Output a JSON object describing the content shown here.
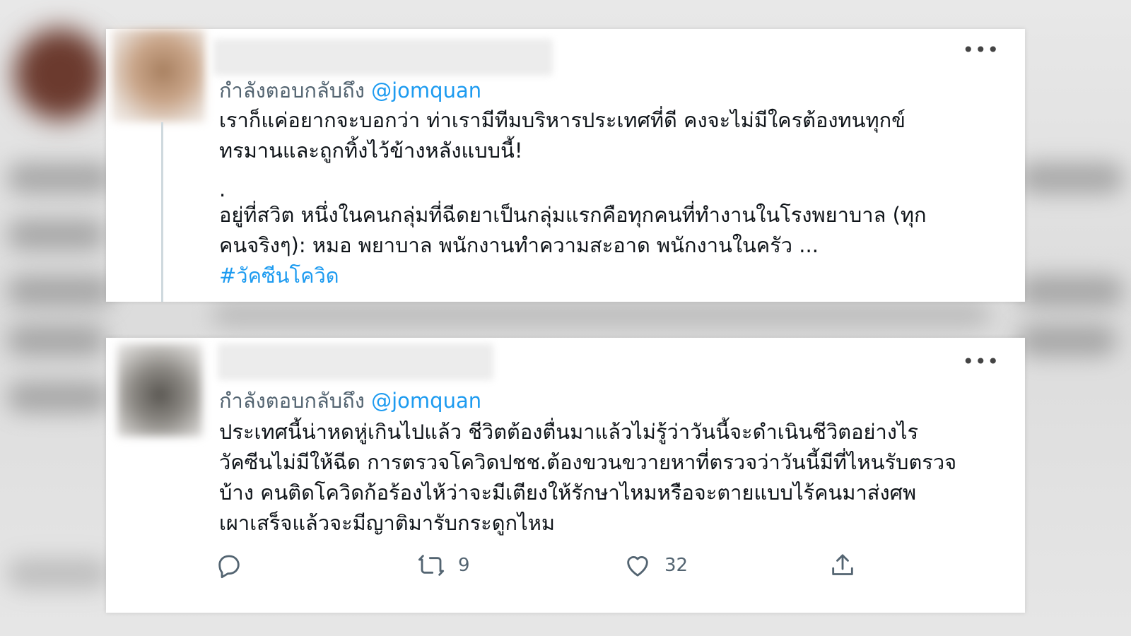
{
  "tweets": [
    {
      "reply_prefix": "กำลังตอบกลับถึง",
      "mention": "@jomquan",
      "text_lines": [
        "เราก็แค่อยากจะบอกว่า ท่าเรามีทีมบริหารประเทศที่ดี คงจะไม่มีใครต้องทนทุกข์",
        "ทรมานและถูกทิ้งไว้ข้างหลังแบบนี้!",
        ".",
        "อยู่ที่สวิต หนึ่งในคนกลุ่มที่ฉีดยาเป็นกลุ่มแรกคือทุกคนที่ทำงานในโรงพยาบาล (ทุก",
        "คนจริงๆ): หมอ พยาบาล พนักงานทำความสะอาด พนักงานในครัว ..."
      ],
      "hashtag": "#วัคซีนโควิด",
      "more_icon": "more-horizontal-icon"
    },
    {
      "reply_prefix": "กำลังตอบกลับถึง",
      "mention": "@jomquan",
      "text_lines": [
        "ประเทศนี้น่าหดหู่เกินไปแล้ว ชีวิตต้องตื่นมาแล้วไม่รู้ว่าวันนี้จะดำเนินชีวิตอย่างไร",
        "วัคซีนไม่มีให้ฉีด การตรวจโควิดปชช.ต้องขวนขวายหาที่ตรวจว่าวันนี้มีที่ไหนรับตรวจ",
        "บ้าง คนติดโควิดก้อร้องไห้ว่าจะมีเตียงให้รักษาไหมหรือจะตายแบบไร้คนมาส่งศพ",
        "เผาเสร็จแล้วจะมีญาติมารับกระดูกไหม"
      ],
      "more_icon": "more-horizontal-icon",
      "actions": {
        "reply_icon": "reply-icon",
        "retweet_icon": "retweet-icon",
        "retweet_count": "9",
        "like_icon": "heart-icon",
        "like_count": "32",
        "share_icon": "share-icon"
      }
    }
  ],
  "colors": {
    "link": "#1d9bf0",
    "secondary_text": "#536471",
    "primary_text": "#0f1419"
  }
}
